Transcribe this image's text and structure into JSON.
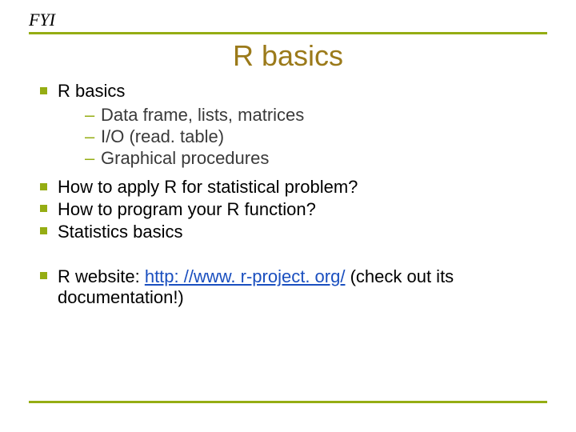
{
  "header": {
    "fyi": "FYI"
  },
  "title": "R basics",
  "bullets": {
    "b1": {
      "label": "R basics",
      "sub": {
        "s1": "Data frame, lists, matrices",
        "s2": "I/O (read. table)",
        "s3": "Graphical procedures"
      }
    },
    "b2": "How to apply R for statistical problem?",
    "b3": "How to program your R function?",
    "b4": "Statistics basics",
    "b5": {
      "pre": "R website: ",
      "link_text": "http: //www. r-project. org/",
      "link_href": "http://www.r-project.org/",
      "post": " (check out its documentation!)"
    }
  }
}
